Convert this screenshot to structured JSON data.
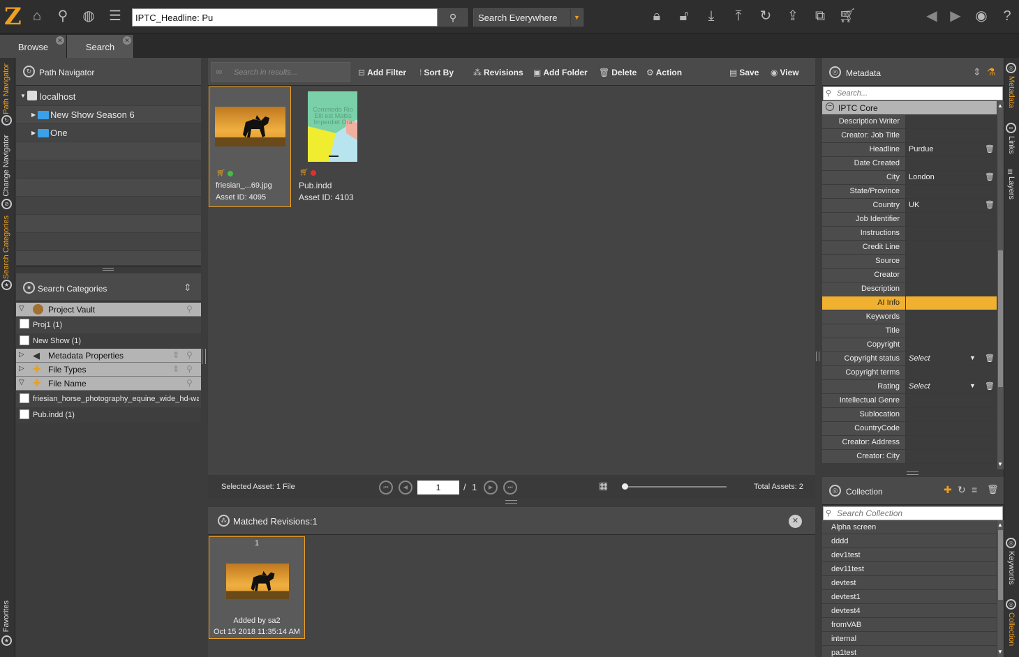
{
  "topbar": {
    "logo": "Z",
    "search_value": "IPTC_Headline: Pu",
    "scope": "Search Everywhere"
  },
  "tabs": [
    {
      "label": "Browse"
    },
    {
      "label": "Search"
    }
  ],
  "left_rail": {
    "path_navigator": "Path Navigator",
    "change_navigator": "Change Navigator",
    "search_categories": "Search Categories",
    "favorites": "Favorites"
  },
  "right_rail": {
    "metadata": "Metadata",
    "links": "Links",
    "layers": "Layers",
    "keywords": "Keywords",
    "collection": "Collection"
  },
  "path_navigator": {
    "title": "Path Navigator",
    "root": "localhost",
    "children": [
      "New Show Season 6",
      "One"
    ]
  },
  "search_categories": {
    "title": "Search Categories",
    "project_vault": "Project Vault",
    "proj1": "Proj1 (1)",
    "new_show": "New Show (1)",
    "metadata_properties": "Metadata Properties",
    "file_types": "File Types",
    "file_name": "File Name",
    "file1": "friesian_horse_photography_equine_wide_hd-wall...",
    "file2": "Pub.indd (1)"
  },
  "toolbar": {
    "search_placeholder": "Search in results...",
    "add_filter": "Add Filter",
    "sort_by": "Sort By",
    "revisions": "Revisions",
    "add_folder": "Add Folder",
    "delete": "Delete",
    "action": "Action",
    "save": "Save",
    "view": "View"
  },
  "assets": [
    {
      "name": "friesian_...69.jpg",
      "id": "Asset ID: 4095"
    },
    {
      "name": "Pub.indd",
      "id": "Asset ID: 4103",
      "thumb_text": "Commodo Rio Elit est Mattis Imperdiet Ora"
    }
  ],
  "status": {
    "selected": "Selected Asset: 1 File",
    "page": "1",
    "of": "/",
    "total_pages": "1",
    "total": "Total Assets: 2",
    "zoom_level": 0
  },
  "revisions": {
    "title": "Matched Revisions:1",
    "number": "1",
    "added_by": "Added by sa2",
    "date": "Oct 15 2018 11:35:14 AM"
  },
  "metadata": {
    "title": "Metadata",
    "search_placeholder": "Search...",
    "group": "IPTC Core",
    "rows": [
      {
        "label": "Description Writer",
        "value": ""
      },
      {
        "label": "Creator: Job Title",
        "value": ""
      },
      {
        "label": "Headline",
        "value": "Purdue"
      },
      {
        "label": "Date Created",
        "value": ""
      },
      {
        "label": "City",
        "value": "London"
      },
      {
        "label": "State/Province",
        "value": ""
      },
      {
        "label": "Country",
        "value": "UK"
      },
      {
        "label": "Job Identifier",
        "value": ""
      },
      {
        "label": "Instructions",
        "value": ""
      },
      {
        "label": "Credit Line",
        "value": ""
      },
      {
        "label": "Source",
        "value": ""
      },
      {
        "label": "Creator",
        "value": ""
      },
      {
        "label": "Description",
        "value": ""
      },
      {
        "label": "AI Info",
        "value": ""
      },
      {
        "label": "Keywords",
        "value": ""
      },
      {
        "label": "Title",
        "value": ""
      },
      {
        "label": "Copyright",
        "value": ""
      },
      {
        "label": "Copyright status",
        "value": "Select"
      },
      {
        "label": "Copyright terms",
        "value": ""
      },
      {
        "label": "Rating",
        "value": "Select"
      },
      {
        "label": "Intellectual Genre",
        "value": ""
      },
      {
        "label": "Sublocation",
        "value": ""
      },
      {
        "label": "CountryCode",
        "value": ""
      },
      {
        "label": "Creator: Address",
        "value": ""
      },
      {
        "label": "Creator: City",
        "value": ""
      }
    ]
  },
  "collection": {
    "title": "Collection",
    "search_placeholder": "Search Collection",
    "items": [
      "Alpha screen",
      "dddd",
      "dev1test",
      "dev11test",
      "devtest",
      "devtest1",
      "devtest4",
      "fromVAB",
      "internal",
      "pa1test"
    ]
  },
  "colors": {
    "accent": "#f0a020",
    "highlight": "#f0b030",
    "background": "#3c3c3c"
  }
}
